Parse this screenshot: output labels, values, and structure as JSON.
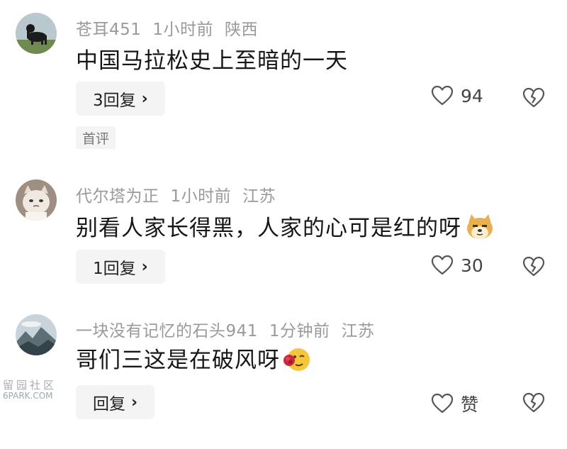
{
  "comments": [
    {
      "username": "苍耳451",
      "time": "1小时前",
      "location": "陕西",
      "text": "中国马拉松史上至暗的一天",
      "reply_label": "3回复",
      "like_count": "94",
      "tag": "首评",
      "avatar_icon": "dog-avatar-icon"
    },
    {
      "username": "代尔塔为正",
      "time": "1小时前",
      "location": "江苏",
      "text": "别看人家长得黑，人家的心可是红的呀",
      "reply_label": "1回复",
      "like_count": "30",
      "emoji_icon": "doge-emoji-icon",
      "avatar_icon": "cat-avatar-icon"
    },
    {
      "username": "一块没有记忆的石头941",
      "time": "1分钟前",
      "location": "江苏",
      "text": "哥们三这是在破风呀",
      "reply_label": "回复",
      "like_count": "赞",
      "emoji_icon": "rose-wink-emoji-icon",
      "avatar_icon": "mountain-avatar-icon"
    }
  ],
  "watermark": {
    "line1": "留园社区",
    "line2": "6PARK.COM"
  },
  "colors": {
    "meta_text": "#9a9a9a",
    "body_text": "#161616",
    "button_bg": "#f4f4f5"
  }
}
